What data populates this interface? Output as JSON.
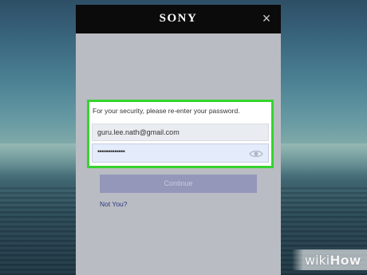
{
  "header": {
    "logo": "SONY",
    "close_label": "×"
  },
  "form": {
    "prompt": "For your security, please re-enter your password.",
    "email_value": "guru.lee.nath@gmail.com",
    "password_value": "•••••••••••••",
    "continue_label": "Continue",
    "not_you_label": "Not You?"
  },
  "watermark": {
    "wiki": "wiki",
    "how": "How"
  },
  "colors": {
    "header_bg": "#0b0b0b",
    "modal_bg": "#b9bcc2",
    "highlight": "#35d42e",
    "button_bg": "#9497ba",
    "link": "#2a3a82"
  },
  "icons": {
    "close": "close-icon",
    "password_toggle": "eye-icon"
  }
}
